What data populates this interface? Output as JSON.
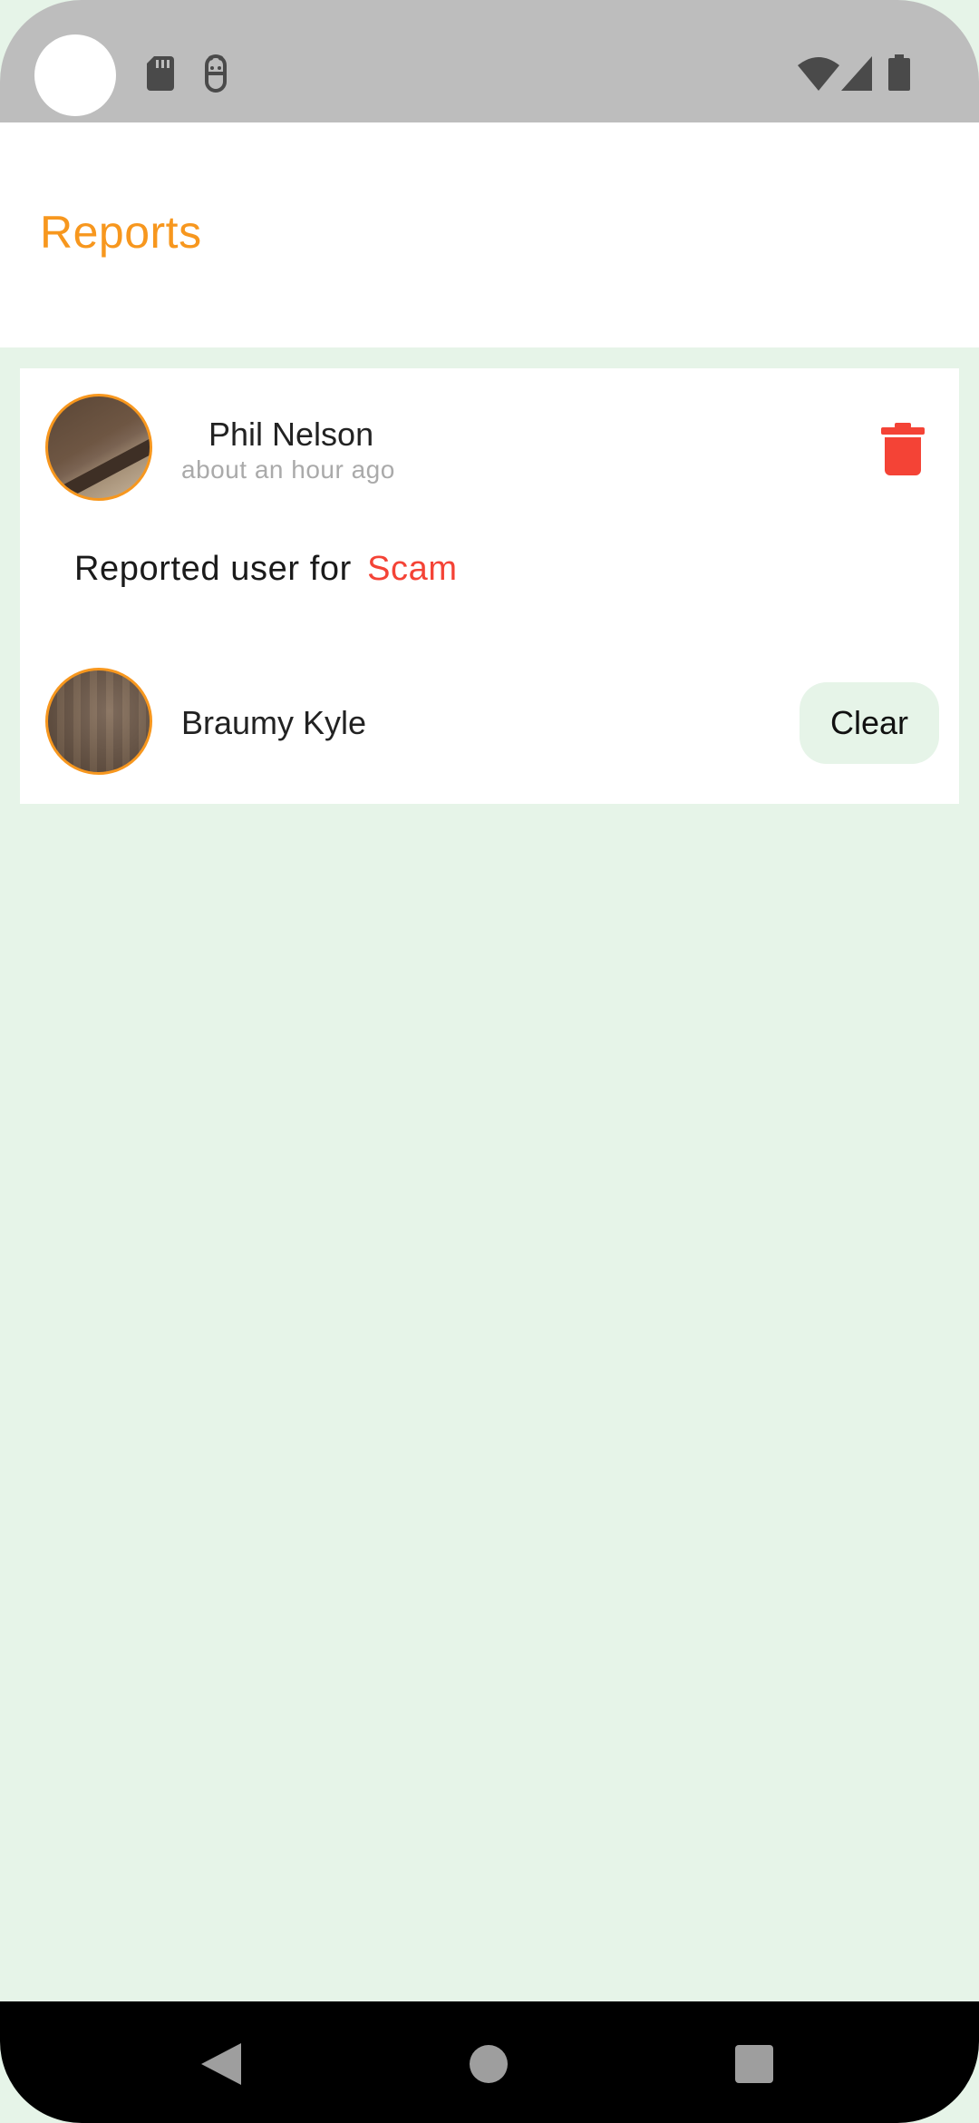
{
  "status_bar": {
    "icons": [
      "sd-card-icon",
      "debug-icon",
      "wifi-icon",
      "signal-icon",
      "battery-icon"
    ]
  },
  "header": {
    "title": "Reports",
    "title_color": "#f7971e"
  },
  "report": {
    "reporter": {
      "name": "Phil Nelson",
      "time": "about an hour ago"
    },
    "text": "Reported user for",
    "reason": "Scam",
    "reason_color": "#f44336",
    "reported_user": {
      "name": "Braumy Kyle"
    },
    "clear_label": "Clear",
    "delete_icon": "trash-icon"
  },
  "nav_bar": {
    "icons": [
      "back-icon",
      "home-icon",
      "recents-icon"
    ]
  },
  "colors": {
    "background": "#e6f4e8",
    "accent": "#f7971e",
    "danger": "#f44336"
  }
}
